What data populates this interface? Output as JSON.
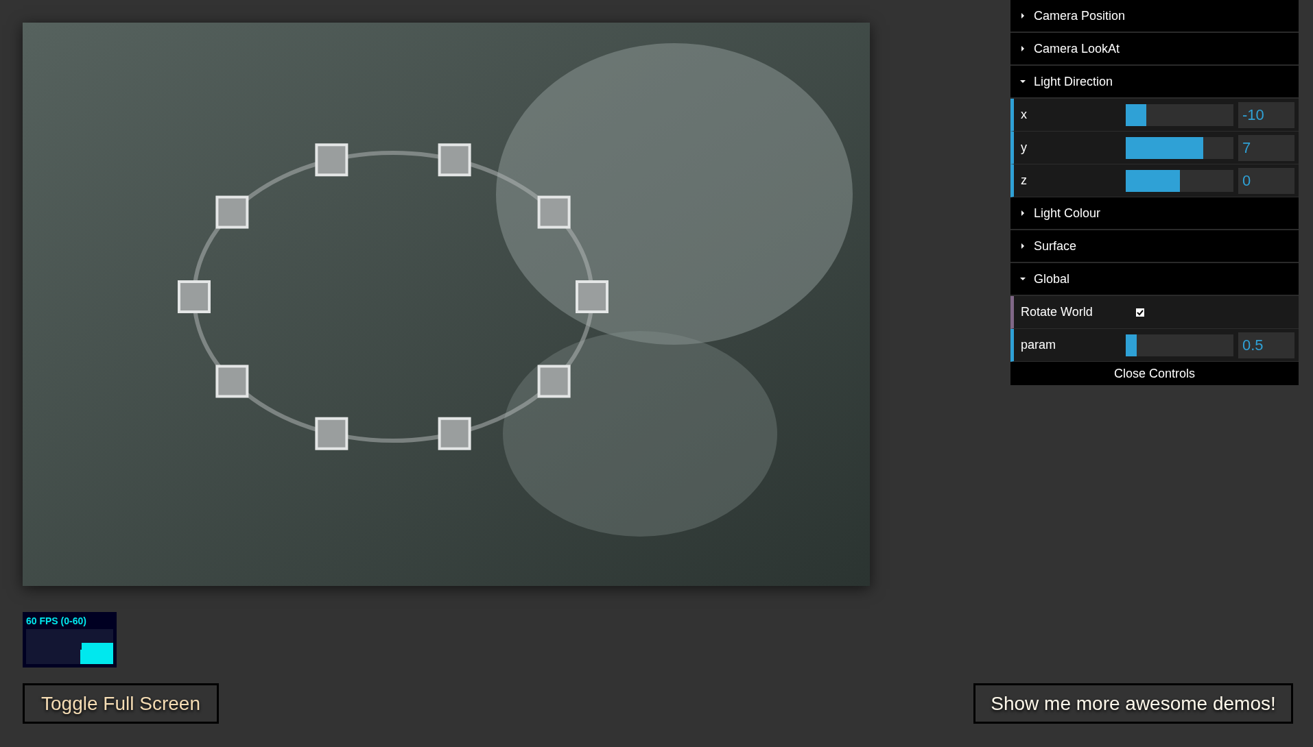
{
  "viewport": {
    "kind": "picture"
  },
  "fps_meter": {
    "label": "60 FPS (0-60)"
  },
  "controls_panel": {
    "folders": [
      {
        "label": "Camera Position",
        "expanded": false
      },
      {
        "label": "Camera LookAt",
        "expanded": false
      },
      {
        "label": "Light Direction",
        "expanded": true,
        "controls": [
          {
            "kind": "slider",
            "label": "x",
            "level": 0.19,
            "value": "-10"
          },
          {
            "kind": "slider",
            "label": "y",
            "level": 0.72,
            "value": "7"
          },
          {
            "kind": "slider",
            "label": "z",
            "level": 0.5,
            "value": "0"
          }
        ]
      },
      {
        "label": "Light Colour",
        "expanded": false
      },
      {
        "label": "Surface",
        "expanded": false
      },
      {
        "label": "Global",
        "expanded": true,
        "controls": [
          {
            "kind": "checkbox",
            "label": "Rotate World",
            "checked": true
          },
          {
            "kind": "slider",
            "label": "param",
            "level": 0.1,
            "value": "0.5"
          }
        ]
      }
    ],
    "close_label": "Close Controls"
  },
  "buttons": [
    "Toggle Full Screen",
    "Show me more awesome demos!"
  ]
}
